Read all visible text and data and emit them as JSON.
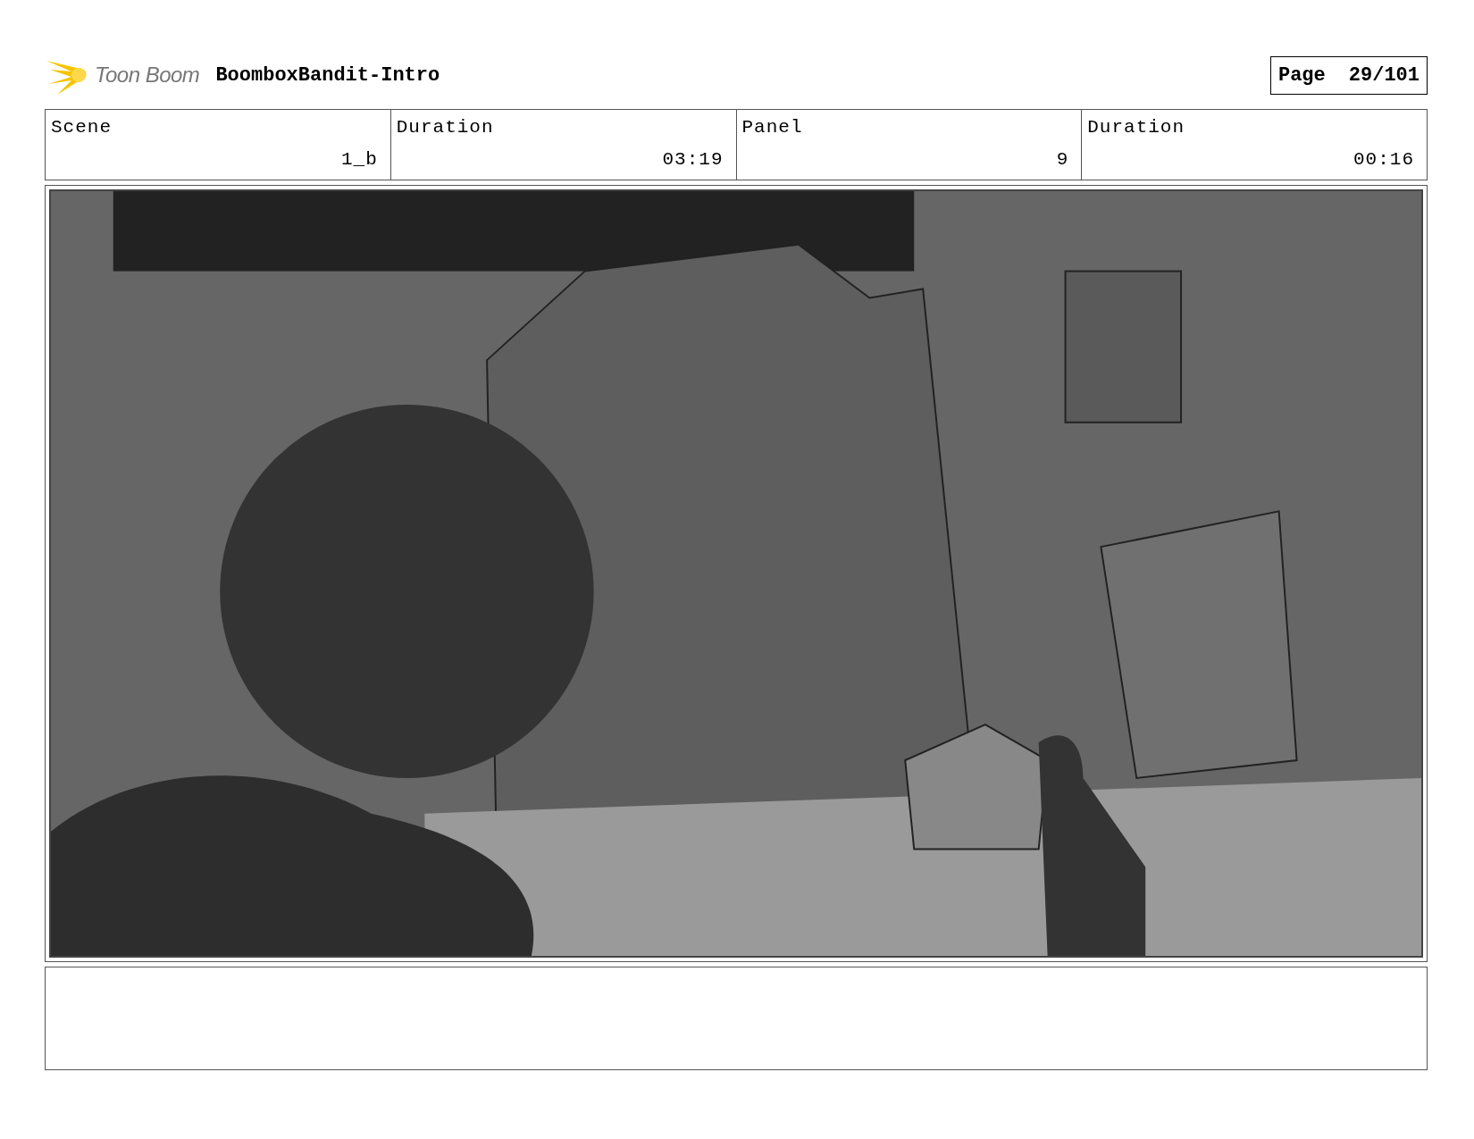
{
  "header": {
    "logo_text": "Toon Boom",
    "title": "BoomboxBandit-Intro",
    "page_label": "Page",
    "page_number": "29/101"
  },
  "info": [
    {
      "label": "Scene",
      "value": "1_b"
    },
    {
      "label": "Duration",
      "value": "03:19"
    },
    {
      "label": "Panel",
      "value": "9"
    },
    {
      "label": "Duration",
      "value": "00:16"
    }
  ]
}
